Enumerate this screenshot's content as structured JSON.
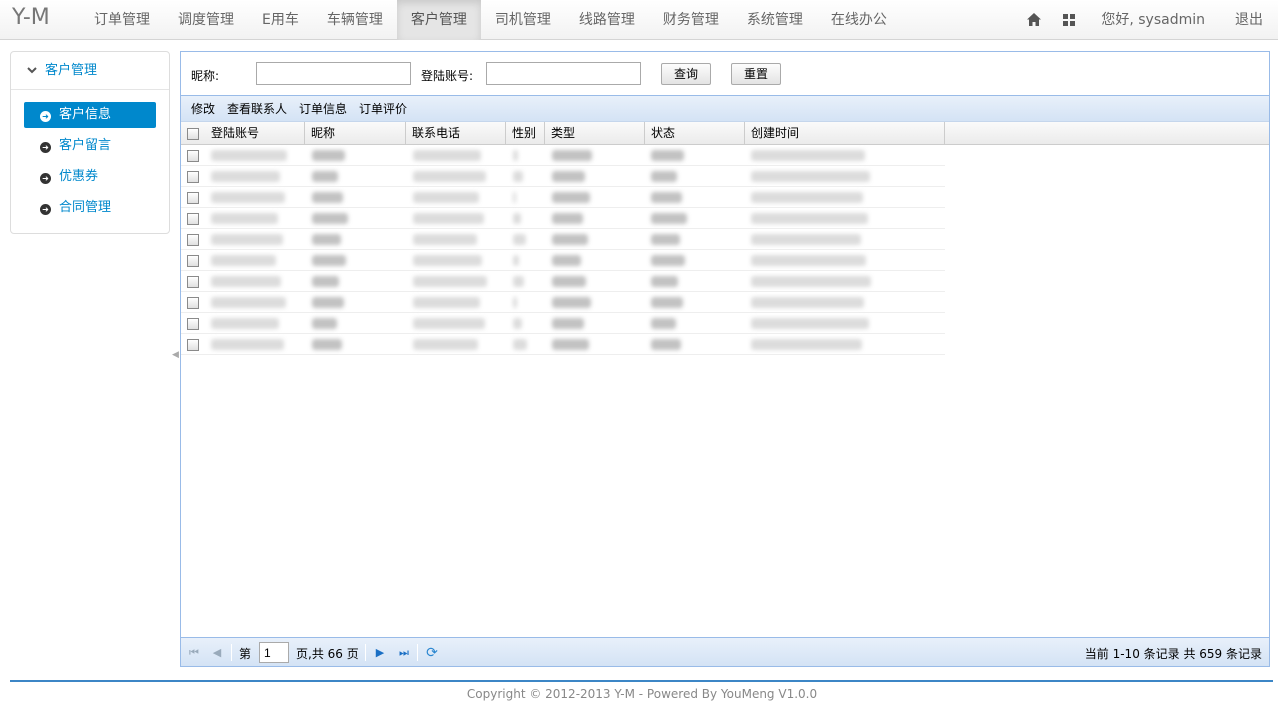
{
  "brand": "Y-M",
  "nav": {
    "items": [
      {
        "label": "订单管理"
      },
      {
        "label": "调度管理"
      },
      {
        "label": "E用车"
      },
      {
        "label": "车辆管理"
      },
      {
        "label": "客户管理",
        "active": true
      },
      {
        "label": "司机管理"
      },
      {
        "label": "线路管理"
      },
      {
        "label": "财务管理"
      },
      {
        "label": "系统管理"
      },
      {
        "label": "在线办公"
      }
    ],
    "home_icon": "home-icon",
    "apps_icon": "grid-icon",
    "greeting": "您好, sysadmin",
    "logout": "退出"
  },
  "sidebar": {
    "title": "客户管理",
    "items": [
      {
        "label": "客户信息",
        "active": true
      },
      {
        "label": "客户留言"
      },
      {
        "label": "优惠券"
      },
      {
        "label": "合同管理"
      }
    ]
  },
  "search": {
    "nickname_label": "昵称:",
    "nickname_value": "",
    "account_label": "登陆账号:",
    "account_value": "",
    "query_btn": "查询",
    "reset_btn": "重置"
  },
  "toolbar": {
    "edit": "修改",
    "contacts": "查看联系人",
    "orders": "订单信息",
    "reviews": "订单评价"
  },
  "grid": {
    "columns": [
      "登陆账号",
      "昵称",
      "联系电话",
      "性别",
      "类型",
      "状态",
      "创建时间"
    ],
    "row_count": 10
  },
  "pager": {
    "page_prefix": "第",
    "page_value": "1",
    "page_suffix": "页,共 66 页",
    "summary": "当前 1-10 条记录 共 659 条记录"
  },
  "footer": "Copyright © 2012-2013 Y-M - Powered By YouMeng V1.0.0",
  "colors": {
    "accent": "#0088cc",
    "panel_border": "#99bbe8",
    "footer_line": "#3c86c6"
  }
}
